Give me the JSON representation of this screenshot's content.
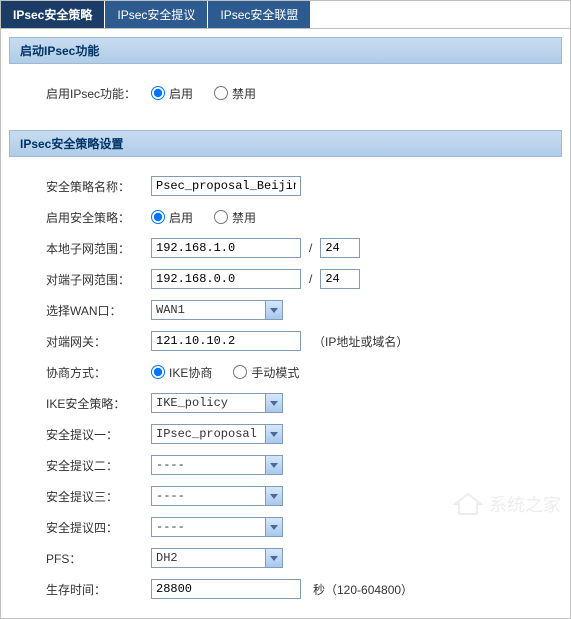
{
  "tabs": [
    {
      "label": "IPsec安全策略",
      "active": true
    },
    {
      "label": "IPsec安全提议",
      "active": false
    },
    {
      "label": "IPsec安全联盟",
      "active": false
    }
  ],
  "section1": {
    "title": "启动IPsec功能",
    "enable_label": "启用IPsec功能：",
    "option_enable": "启用",
    "option_disable": "禁用"
  },
  "section2": {
    "title": "IPsec安全策略设置",
    "policy_name_label": "安全策略名称：",
    "policy_name_value": "Psec_proposal_Beijing",
    "enable_policy_label": "启用安全策略：",
    "option_enable": "启用",
    "option_disable": "禁用",
    "local_subnet_label": "本地子网范围：",
    "local_subnet_value": "192.168.1.0",
    "local_mask_value": "24",
    "remote_subnet_label": "对端子网范围：",
    "remote_subnet_value": "192.168.0.0",
    "remote_mask_value": "24",
    "wan_label": "选择WAN口：",
    "wan_value": "WAN1",
    "remote_gw_label": "对端网关：",
    "remote_gw_value": "121.10.10.2",
    "remote_gw_hint": "（IP地址或域名）",
    "nego_label": "协商方式：",
    "nego_ike": "IKE协商",
    "nego_manual": "手动模式",
    "ike_policy_label": "IKE安全策略：",
    "ike_policy_value": "IKE_policy",
    "proposal1_label": "安全提议一：",
    "proposal1_value": "IPsec_proposal",
    "proposal2_label": "安全提议二：",
    "proposal2_value": "----",
    "proposal3_label": "安全提议三：",
    "proposal3_value": "----",
    "proposal4_label": "安全提议四：",
    "proposal4_value": "----",
    "pfs_label": "PFS：",
    "pfs_value": "DH2",
    "lifetime_label": "生存时间：",
    "lifetime_value": "28800",
    "lifetime_hint": "秒（120-604800）"
  },
  "watermark": "系统之家"
}
